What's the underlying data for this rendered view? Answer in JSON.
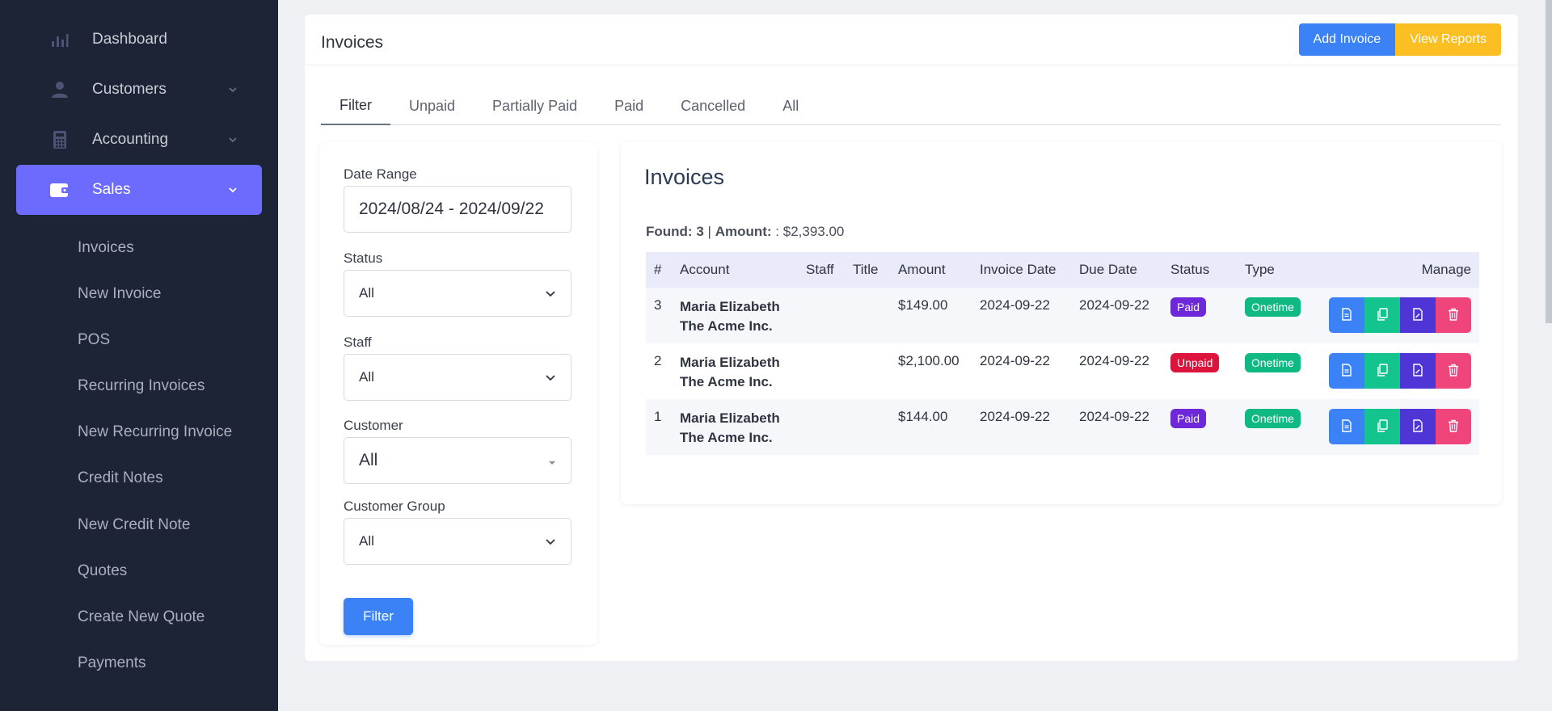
{
  "sidebar": {
    "items": [
      {
        "label": "Dashboard",
        "icon": "bar-chart-icon"
      },
      {
        "label": "Customers",
        "icon": "user-icon"
      },
      {
        "label": "Accounting",
        "icon": "calculator-icon"
      },
      {
        "label": "Sales",
        "icon": "wallet-icon"
      }
    ],
    "sales_sub": [
      "Invoices",
      "New Invoice",
      "POS",
      "Recurring Invoices",
      "New Recurring Invoice",
      "Credit Notes",
      "New Credit Note",
      "Quotes",
      "Create New Quote",
      "Payments"
    ]
  },
  "header": {
    "title": "Invoices",
    "add_invoice": "Add Invoice",
    "view_reports": "View Reports"
  },
  "tabs": [
    "Filter",
    "Unpaid",
    "Partially Paid",
    "Paid",
    "Cancelled",
    "All"
  ],
  "filter": {
    "date_range_label": "Date Range",
    "date_range_value": "2024/08/24 - 2024/09/22",
    "status_label": "Status",
    "status_value": "All",
    "staff_label": "Staff",
    "staff_value": "All",
    "customer_label": "Customer",
    "customer_value": "All",
    "customer_group_label": "Customer Group",
    "customer_group_value": "All",
    "filter_button": "Filter"
  },
  "invoices": {
    "title": "Invoices",
    "found_label": "Found:",
    "found_count": "3",
    "separator": "|",
    "amount_label": "Amount:",
    "amount_value": ": $2,393.00",
    "columns": [
      "#",
      "Account",
      "Staff",
      "Title",
      "Amount",
      "Invoice Date",
      "Due Date",
      "Status",
      "Type",
      "Manage"
    ],
    "rows": [
      {
        "num": "3",
        "name": "Maria Elizabeth",
        "company": "The Acme Inc.",
        "staff": "",
        "title": "",
        "amount": "$149.00",
        "invoice_date": "2024-09-22",
        "due_date": "2024-09-22",
        "status": "Paid",
        "type": "Onetime"
      },
      {
        "num": "2",
        "name": "Maria Elizabeth",
        "company": "The Acme Inc.",
        "staff": "",
        "title": "",
        "amount": "$2,100.00",
        "invoice_date": "2024-09-22",
        "due_date": "2024-09-22",
        "status": "Unpaid",
        "type": "Onetime"
      },
      {
        "num": "1",
        "name": "Maria Elizabeth",
        "company": "The Acme Inc.",
        "staff": "",
        "title": "",
        "amount": "$144.00",
        "invoice_date": "2024-09-22",
        "due_date": "2024-09-22",
        "status": "Paid",
        "type": "Onetime"
      }
    ]
  },
  "colors": {
    "sidebar_bg": "#1c2436",
    "sidebar_active": "#6c6bfd",
    "primary": "#3b82f6",
    "warning": "#fbbf24",
    "paid": "#6d28d9",
    "unpaid": "#dc143c",
    "onetime": "#10b981",
    "btn_view": "#3b82f6",
    "btn_clone": "#14c48f",
    "btn_edit": "#4f35d6",
    "btn_delete": "#f0457a"
  }
}
